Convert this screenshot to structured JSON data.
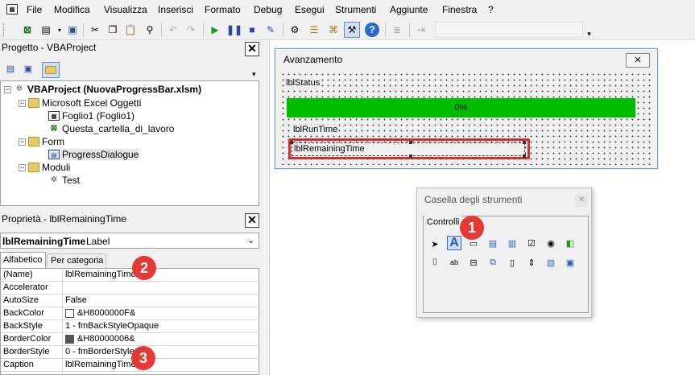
{
  "menu": {
    "items": [
      "File",
      "Modifica",
      "Visualizza",
      "Inserisci",
      "Formato",
      "Debug",
      "Esegui",
      "Strumenti",
      "Aggiunte",
      "Finestra",
      "?"
    ]
  },
  "project_panel": {
    "title": "Progetto - VBAProject",
    "root": "VBAProject (NuovaProgressBar.xlsm)",
    "excel_objects": "Microsoft Excel Oggetti",
    "sheet1": "Foglio1 (Foglio1)",
    "workbook": "Questa_cartella_di_lavoro",
    "forms_folder": "Form",
    "form_item": "ProgressDialogue",
    "modules_folder": "Moduli",
    "module_item": "Test"
  },
  "properties_panel": {
    "title": "Proprietà - lblRemainingTime",
    "object_name": "lblRemainingTime",
    "object_type": "Label",
    "tab_alpha": "Alfabetico",
    "tab_category": "Per categoria",
    "rows": [
      {
        "name": "(Name)",
        "value": "lblRemainingTime"
      },
      {
        "name": "Accelerator",
        "value": ""
      },
      {
        "name": "AutoSize",
        "value": "False"
      },
      {
        "name": "BackColor",
        "value": "&H8000000F&"
      },
      {
        "name": "BackStyle",
        "value": "1 - fmBackStyleOpaque"
      },
      {
        "name": "BorderColor",
        "value": "&H80000006&"
      },
      {
        "name": "BorderStyle",
        "value": "0 - fmBorderStyle"
      },
      {
        "name": "Caption",
        "value": "lblRemainingTime"
      }
    ]
  },
  "userform": {
    "title": "Avanzamento",
    "lbl_status": "lblStatus",
    "progress_text": "0%",
    "progress_color": "#00bb00",
    "lbl_runtime": "lblRunTime",
    "lbl_remaining": "lblRemainingTime"
  },
  "toolbox": {
    "title": "Casella degli strumenti",
    "tab": "Controlli"
  },
  "badges": [
    "1",
    "2",
    "3"
  ],
  "colors": {
    "highlight": "#e53935",
    "progress": "#00bb00"
  }
}
